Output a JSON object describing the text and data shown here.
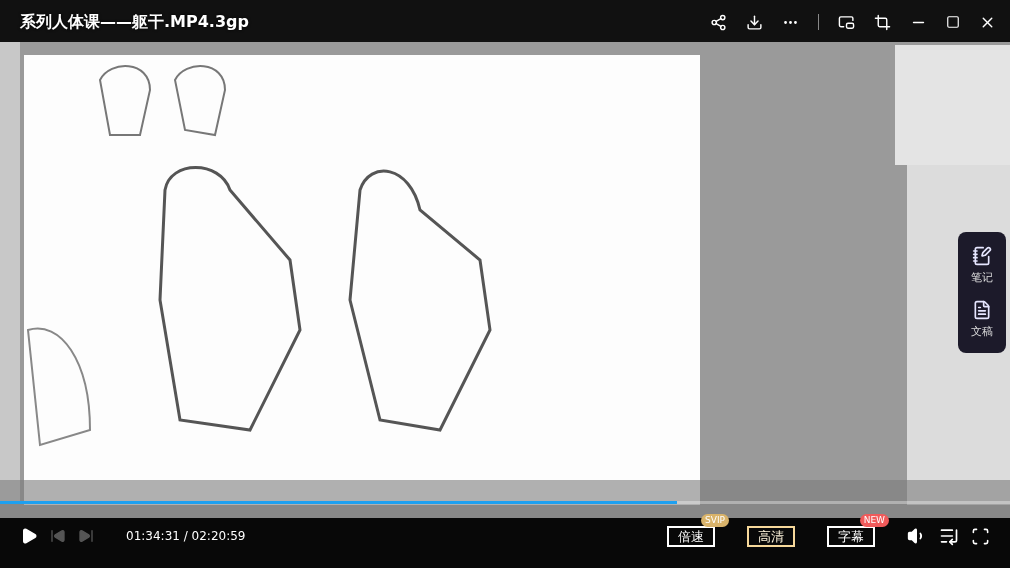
{
  "title": "系列人体课——躯干.MP4.3gp",
  "progress": {
    "level": 0.67
  },
  "time": "01:34:31 / 02:20:59",
  "options": [
    {
      "label": "倍速",
      "selected": false,
      "badge": "SVIP",
      "color": "#d9b36a"
    },
    {
      "label": "高清",
      "selected": true
    },
    {
      "label": "字幕",
      "selected": false,
      "badge": "NEW",
      "color": "#f05a5a"
    }
  ],
  "side_panel": [
    {
      "label": "笔记",
      "kind": "note"
    },
    {
      "label": "文稿",
      "kind": "document"
    }
  ]
}
